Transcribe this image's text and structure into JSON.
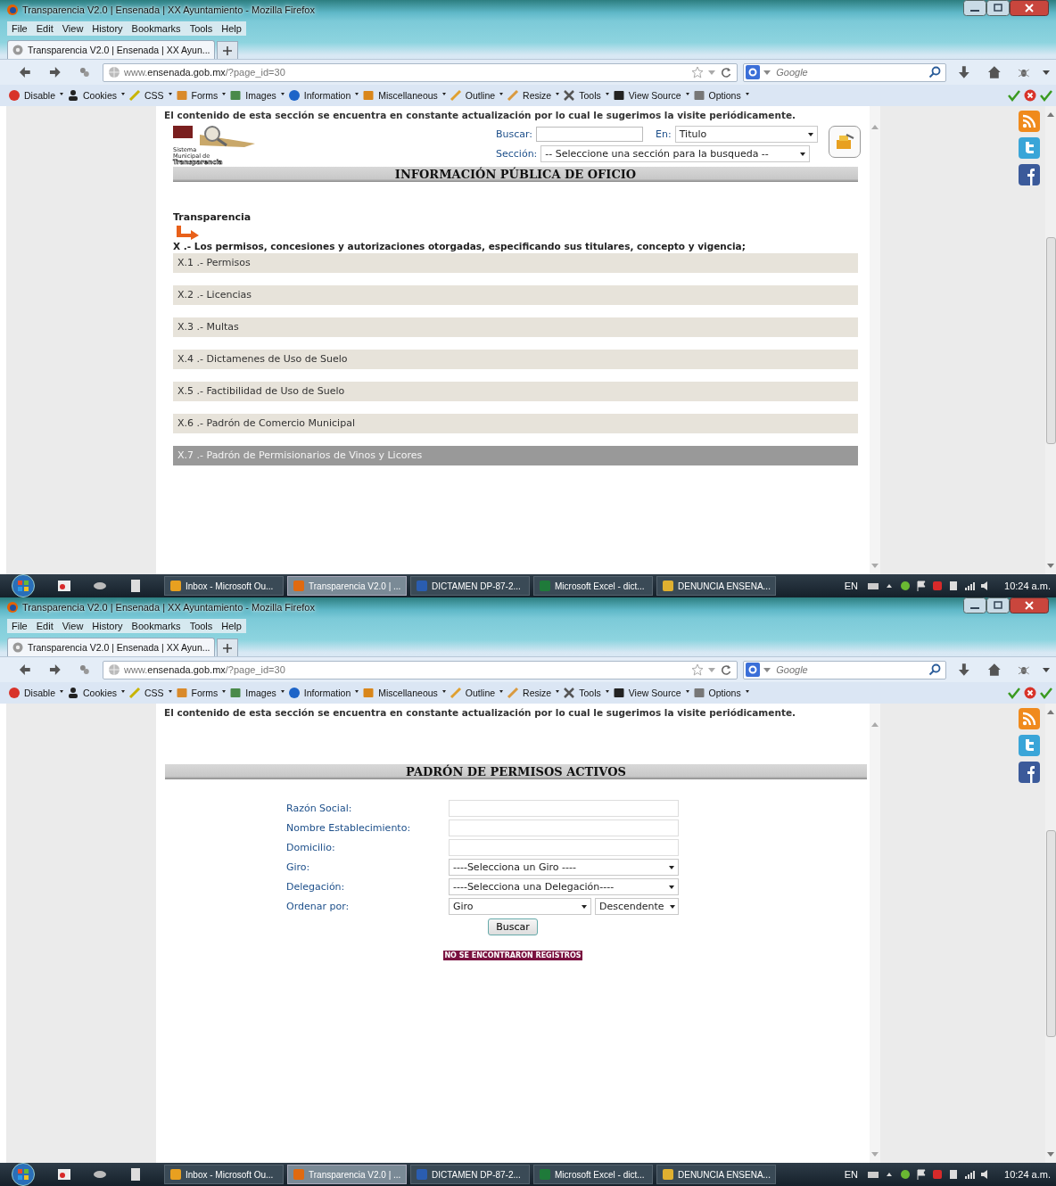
{
  "windows": [
    {
      "title": "Transparencia V2.0 | Ensenada | XX Ayuntamiento - Mozilla Firefox",
      "menu": [
        "File",
        "Edit",
        "View",
        "History",
        "Bookmarks",
        "Tools",
        "Help"
      ],
      "tab": "Transparencia V2.0 | Ensenada | XX Ayun...",
      "url": {
        "prefix": "www.",
        "host": "ensenada.gob.mx",
        "path": "/?page_id=30"
      },
      "search_placeholder": "Google",
      "dev_toolbar": [
        "Disable",
        "Cookies",
        "CSS",
        "Forms",
        "Images",
        "Information",
        "Miscellaneous",
        "Outline",
        "Resize",
        "Tools",
        "View Source",
        "Options"
      ],
      "page": {
        "kind": "list",
        "notice": "El contenido de esta sección se encuentra en constante actualización por lo cual le sugerimos la visite periódicamente.",
        "logo_text": [
          "Sistema",
          "Municipal de",
          "Transparencia"
        ],
        "search": {
          "label": "Buscar:",
          "in_label": "En:",
          "in_value": "Titulo",
          "section_label": "Sección:",
          "section_value": "-- Seleccione una sección para la busqueda --"
        },
        "heading": "INFORMACIÓN PÚBLICA DE OFICIO",
        "subheading": "Transparencia",
        "intro": "X .- Los permisos, concesiones y autorizaciones otorgadas, especificando sus titulares, concepto y vigencia;",
        "items": [
          {
            "label": "X.1 .- Permisos",
            "selected": false
          },
          {
            "label": "X.2 .- Licencias",
            "selected": false
          },
          {
            "label": "X.3 .- Multas",
            "selected": false
          },
          {
            "label": "X.4 .- Dictamenes de Uso de Suelo",
            "selected": false
          },
          {
            "label": "X.5 .- Factibilidad de Uso de Suelo",
            "selected": false
          },
          {
            "label": "X.6 .- Padrón de Comercio Municipal",
            "selected": false
          },
          {
            "label": "X.7 .- Padrón de Permisionarios de Vinos y Licores",
            "selected": true
          }
        ]
      },
      "taskbar": {
        "tasks": [
          {
            "label": "Inbox - Microsoft Ou...",
            "selected": false
          },
          {
            "label": "Transparencia V2.0 | ...",
            "selected": true
          },
          {
            "label": "DICTAMEN DP-87-2...",
            "selected": false
          },
          {
            "label": "Microsoft Excel - dict...",
            "selected": false
          },
          {
            "label": "DENUNCIA ENSENA...",
            "selected": false
          }
        ],
        "language": "EN",
        "clock": "10:24 a.m."
      }
    },
    {
      "title": "Transparencia V2.0 | Ensenada | XX Ayuntamiento - Mozilla Firefox",
      "menu": [
        "File",
        "Edit",
        "View",
        "History",
        "Bookmarks",
        "Tools",
        "Help"
      ],
      "tab": "Transparencia V2.0 | Ensenada | XX Ayun...",
      "url": {
        "prefix": "www.",
        "host": "ensenada.gob.mx",
        "path": "/?page_id=30"
      },
      "search_placeholder": "Google",
      "dev_toolbar": [
        "Disable",
        "Cookies",
        "CSS",
        "Forms",
        "Images",
        "Information",
        "Miscellaneous",
        "Outline",
        "Resize",
        "Tools",
        "View Source",
        "Options"
      ],
      "page": {
        "kind": "form",
        "notice": "El contenido de esta sección se encuentra en constante actualización por lo cual le sugerimos la visite periódicamente.",
        "heading": "PADRÓN DE PERMISOS ACTIVOS",
        "fields": [
          {
            "label": "Razón Social:",
            "kind": "text"
          },
          {
            "label": "Nombre Establecimiento:",
            "kind": "text"
          },
          {
            "label": "Domicilio:",
            "kind": "text"
          },
          {
            "label": "Giro:",
            "kind": "select",
            "value": "----Selecciona un Giro ----"
          },
          {
            "label": "Delegación:",
            "kind": "select",
            "value": "----Selecciona una Delegación----"
          },
          {
            "label": "Ordenar por:",
            "kind": "pair",
            "value": "Giro",
            "value2": "Descendente"
          }
        ],
        "button": "Buscar",
        "message": "NO SE ENCONTRARON REGISTROS"
      },
      "taskbar": {
        "tasks": [
          {
            "label": "Inbox - Microsoft Ou...",
            "selected": false
          },
          {
            "label": "Transparencia V2.0 | ...",
            "selected": true
          },
          {
            "label": "DICTAMEN DP-87-2...",
            "selected": false
          },
          {
            "label": "Microsoft Excel - dict...",
            "selected": false
          },
          {
            "label": "DENUNCIA ENSENA...",
            "selected": false
          }
        ],
        "language": "EN",
        "clock": "10:24 a.m."
      }
    }
  ]
}
